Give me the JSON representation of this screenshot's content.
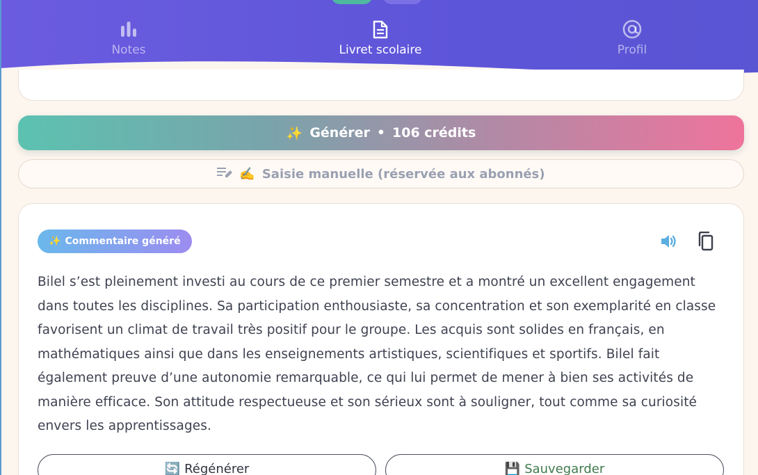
{
  "nav": {
    "items": [
      {
        "label": "Notes",
        "icon": "bar-chart-icon"
      },
      {
        "label": "Livret scolaire",
        "icon": "document-icon"
      },
      {
        "label": "Profil",
        "icon": "at-sign-icon"
      }
    ],
    "active": "Livret scolaire"
  },
  "generate": {
    "icon": "✨",
    "label": "Générer",
    "separator": "•",
    "credits": "106 crédits"
  },
  "manual": {
    "icon": "edit-note-icon",
    "emoji": "✍️",
    "label": "Saisie manuelle (réservée aux abonnés)"
  },
  "comment_card": {
    "badge_icon": "✨",
    "badge_label": "Commentaire généré",
    "text": "Bilel s’est pleinement investi au cours de ce premier semestre et a montré un excellent engagement dans toutes les disciplines. Sa participation enthousiaste, sa concentration et son exemplarité en classe favorisent un climat de travail très positif pour le groupe. Les acquis sont solides en français, en mathématiques ainsi que dans les enseignements artistiques, scientifiques et sportifs. Bilel fait également preuve d’une autonomie remarquable, ce qui lui permet de mener à bien ses activités de manière efficace. Son attitude respectueuse et son sérieux sont à souligner, tout comme sa curiosité envers les apprentissages.",
    "regenerate_icon": "🔄",
    "regenerate_label": "Régénérer",
    "save_icon": "💾",
    "save_label": "Sauvegarder"
  },
  "colors": {
    "header": "#5d55d9",
    "generate_start": "#5cc2b0",
    "generate_end": "#ef749c",
    "badge_start": "#6ab8ec",
    "badge_end": "#9c8cf0",
    "speaker": "#5aaee0",
    "save_text": "#3f7a4c"
  }
}
